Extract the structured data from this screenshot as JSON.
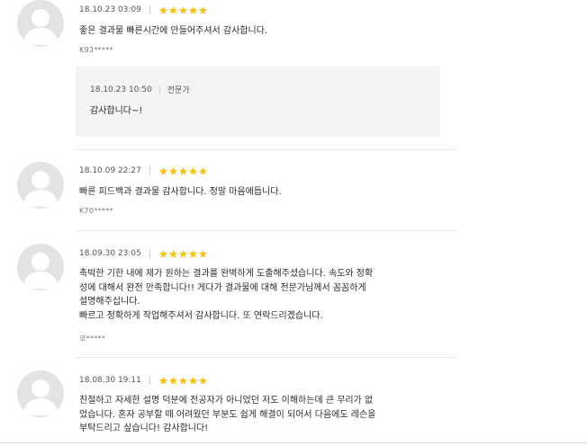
{
  "colors": {
    "star": "#f6c414",
    "divider": "#ececec",
    "reply_bg": "#f4f4f4",
    "avatar_bg": "#e3e3e3"
  },
  "reviews": [
    {
      "date": "18.10.23 03:09",
      "rating": 5,
      "lines": [
        "좋은 결과물 빠른시간에 만들어주셔서 감사합니다."
      ],
      "user": "K93*****",
      "reply": {
        "date": "18.10.23 10:50",
        "author": "전문가",
        "text": "감사합니다~!"
      }
    },
    {
      "date": "18.10.09 22:27",
      "rating": 5,
      "lines": [
        "빠른 피드백과 결과물 감사합니다. 정말 마음에듭니다."
      ],
      "user": "K70*****"
    },
    {
      "date": "18.09.30 23:05",
      "rating": 5,
      "lines": [
        "촉박한 기한 내에 제가 원하는 결과를 완벽하게 도출해주셨습니다. 속도와 정확",
        "성에 대해서 완전 만족합니다!! 게다가 결과물에 대해 전문가님께서 꼼꼼하게",
        "설명해주십니다.",
        "빠르고 정확하게 작업해주셔서 감사합니다. 또 연락드리겠습니다."
      ],
      "user": "코*****"
    },
    {
      "date": "18.08.30 19:11",
      "rating": 5,
      "lines": [
        "친절하고 자세한 설명 덕분에 전공자가 아니었던 저도 이해하는데 큰 무리가 없",
        "었습니다. 혼자 공부할 때 어려웠던 부분도 쉽게 해결이 되어서 다음에도 레슨을",
        "부탁드리고 싶습니다! 감사합니다!"
      ]
    }
  ]
}
